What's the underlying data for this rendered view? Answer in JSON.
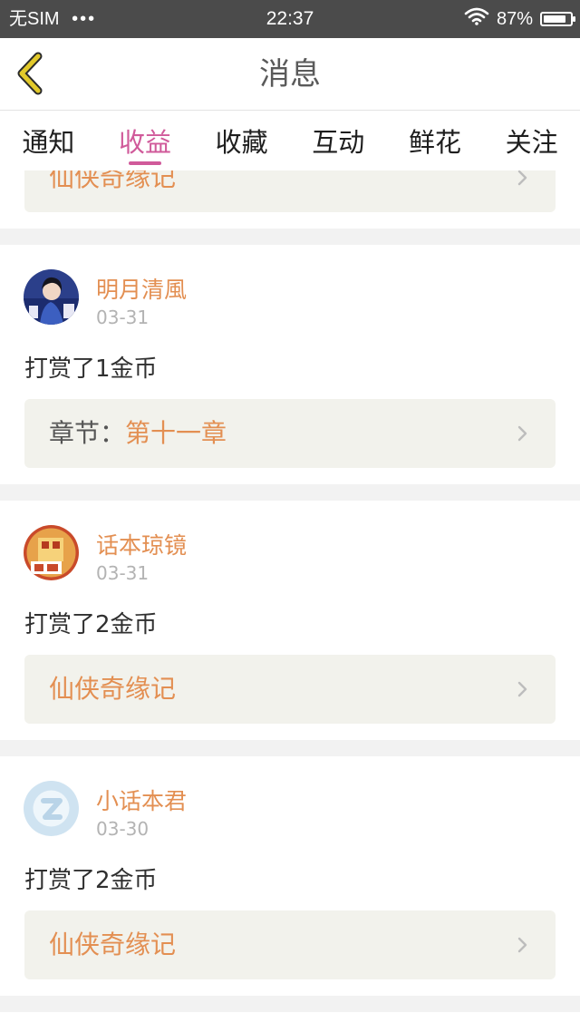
{
  "status_bar": {
    "carrier": "无SIM",
    "signal_dots": "•••",
    "time": "22:37",
    "battery_percent": "87%",
    "battery_level": 0.87,
    "wifi_icon": "wifi-icon",
    "battery_icon": "battery-icon"
  },
  "header": {
    "title": "消息",
    "back_icon": "chevron-left-icon",
    "accent_color": "#e2c92a"
  },
  "tabs": {
    "items": [
      {
        "label": "通知",
        "active": false
      },
      {
        "label": "收益",
        "active": true
      },
      {
        "label": "收藏",
        "active": false
      },
      {
        "label": "互动",
        "active": false
      },
      {
        "label": "鲜花",
        "active": false
      },
      {
        "label": "关注",
        "active": false
      }
    ],
    "active_color": "#d05a9a"
  },
  "messages": [
    {
      "link_text": "仙侠奇缘记"
    },
    {
      "username": "明月清風",
      "date": "03-31",
      "text": "打赏了1金币",
      "link_prefix": "章节：",
      "link_text": "第十一章"
    },
    {
      "username": "话本琼镜",
      "date": "03-31",
      "text": "打赏了2金币",
      "link_text": "仙侠奇缘记"
    },
    {
      "username": "小话本君",
      "date": "03-30",
      "text": "打赏了2金币",
      "link_text": "仙侠奇缘记"
    }
  ],
  "colors": {
    "name": "#e38f52",
    "link_box_bg": "#f2f2ec"
  }
}
